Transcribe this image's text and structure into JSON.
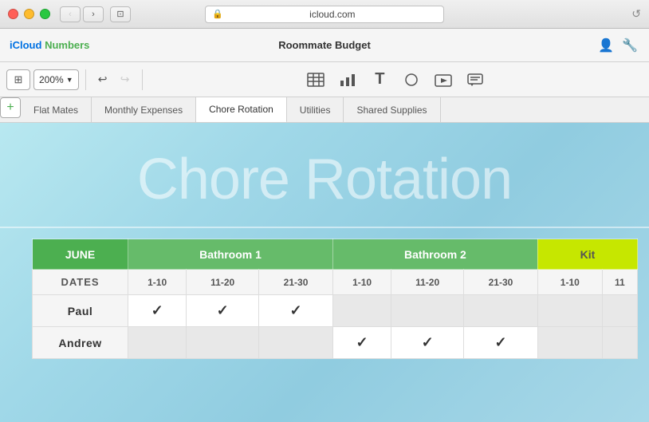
{
  "window": {
    "url": "icloud.com",
    "title": "Roommate Budget",
    "app_name": "iCloud",
    "app_product": "Numbers"
  },
  "toolbar": {
    "zoom": "200%",
    "undo_label": "↩",
    "redo_label": "↪"
  },
  "tabs": [
    {
      "id": "flat-mates",
      "label": "Flat Mates",
      "active": false
    },
    {
      "id": "monthly-expenses",
      "label": "Monthly Expenses",
      "active": false
    },
    {
      "id": "chore-rotation",
      "label": "Chore Rotation",
      "active": true
    },
    {
      "id": "utilities",
      "label": "Utilities",
      "active": false
    },
    {
      "id": "shared-supplies",
      "label": "Shared Supplies",
      "active": false
    }
  ],
  "sheet": {
    "title": "Chore Rotation",
    "table": {
      "month": "JUNE",
      "columns": [
        {
          "label": "Bathroom 1",
          "subheaders": [
            "1-10",
            "11-20",
            "21-30"
          ]
        },
        {
          "label": "Bathroom 2",
          "subheaders": [
            "1-10",
            "11-20",
            "21-30"
          ]
        },
        {
          "label": "Kit",
          "subheaders": [
            "1-10",
            "11"
          ]
        }
      ],
      "dates_label": "DATES",
      "rows": [
        {
          "name": "Paul",
          "bathroom1": [
            true,
            true,
            true
          ],
          "bathroom2": [
            false,
            false,
            false
          ],
          "kit": [
            false,
            false
          ]
        },
        {
          "name": "Andrew",
          "bathroom1": [
            false,
            false,
            false
          ],
          "bathroom2": [
            true,
            true,
            true
          ],
          "kit": [
            false,
            false
          ]
        }
      ]
    }
  },
  "icons": {
    "table": "⊞",
    "chart": "📊",
    "text": "T",
    "shape": "◻",
    "media": "▶",
    "comment": "≡",
    "share": "👤",
    "settings": "🔧",
    "lock": "🔒",
    "reload": "↺",
    "back": "‹",
    "forward": "›",
    "windowmode": "⊡",
    "checkmark": "✓"
  },
  "colors": {
    "green_tab_active": "#4CAF50",
    "header_green": "#66BB6A",
    "header_lime": "#C6E700",
    "june_green": "#4CAF50"
  }
}
